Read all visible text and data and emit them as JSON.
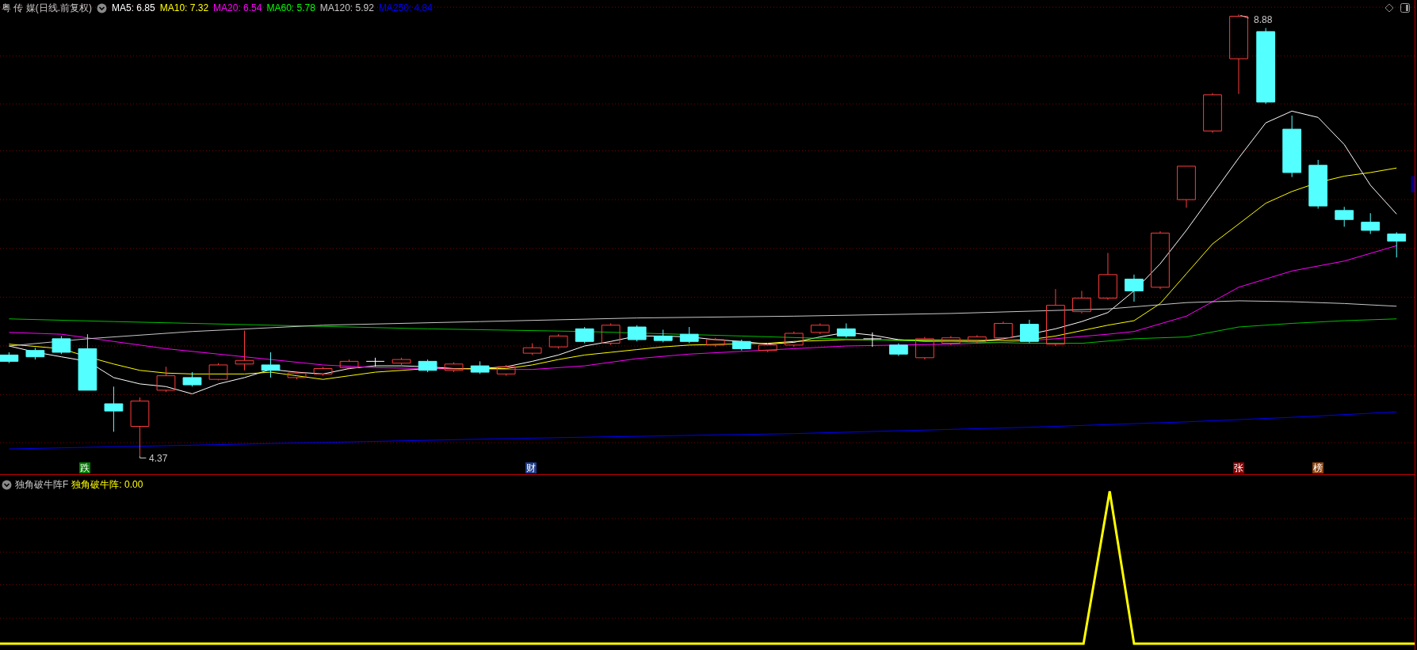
{
  "header": {
    "title": "粤 传 媒(日线.前复权)",
    "indicators": [
      {
        "label": "MA5: 6.85",
        "color": "#ffffff"
      },
      {
        "label": "MA10: 7.32",
        "color": "#ffff00"
      },
      {
        "label": "MA20: 6.54",
        "color": "#ff00ff"
      },
      {
        "label": "MA60: 5.78",
        "color": "#00ff00"
      },
      {
        "label": "MA120: 5.92",
        "color": "#c8c8c8"
      },
      {
        "label": "MA250: 4.84",
        "color": "#0000ff"
      }
    ]
  },
  "price_labels": [
    {
      "text": "8.88"
    },
    {
      "text": "4.37"
    }
  ],
  "event_markers": [
    {
      "text": "跌",
      "color": "#007a00"
    },
    {
      "text": "财",
      "color": "#1c3c8c"
    },
    {
      "text": "张",
      "color": "#8b0000"
    },
    {
      "text": "榜",
      "color": "#8b4513"
    }
  ],
  "lower_panel": {
    "title": "独角破牛阵F",
    "indicator": {
      "label": "独角破牛阵: 0.00",
      "color": "#ffff00"
    }
  }
}
